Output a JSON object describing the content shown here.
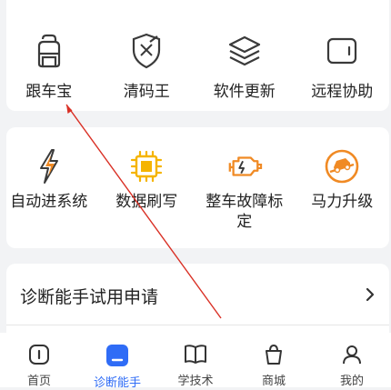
{
  "tools_top": [
    {
      "label": "跟车宝",
      "icon": "backpack-icon"
    },
    {
      "label": "清码王",
      "icon": "shield-broom-icon"
    },
    {
      "label": "软件更新",
      "icon": "layers-icon"
    },
    {
      "label": "远程协助",
      "icon": "tablet-icon"
    }
  ],
  "tools_bottom": [
    {
      "label": "自动进系统",
      "icon": "lightning-icon"
    },
    {
      "label": "数据刷写",
      "icon": "chip-icon"
    },
    {
      "label": "整车故障标定",
      "icon": "engine-icon"
    },
    {
      "label": "马力升级",
      "icon": "car-slope-icon"
    }
  ],
  "apply": {
    "label": "诊断能手试用申请"
  },
  "tabs": [
    {
      "label": "首页",
      "icon": "home-icon"
    },
    {
      "label": "诊断能手",
      "icon": "diagnosis-icon",
      "active": true
    },
    {
      "label": "学技术",
      "icon": "book-icon"
    },
    {
      "label": "商城",
      "icon": "mall-icon"
    },
    {
      "label": "我的",
      "icon": "profile-icon"
    }
  ],
  "colors": {
    "accent": "#2f6cf6",
    "orange": "#f08a24",
    "yellow": "#f5b400",
    "annotation": "#d93025"
  }
}
